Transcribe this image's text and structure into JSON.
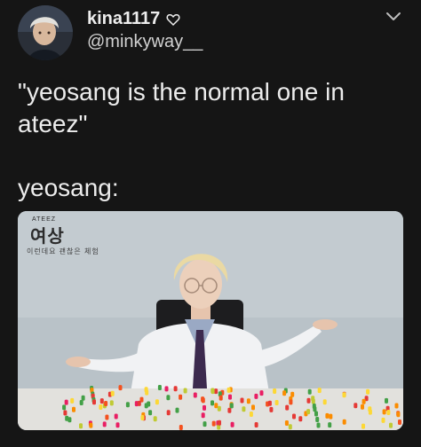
{
  "tweet": {
    "display_name": "kina1117",
    "handle": "@minkyway__",
    "text": "\"yeosang is the normal one in ateez\"\n\nyeosang:"
  },
  "icons": {
    "heart": "heart-outline-icon",
    "chevron": "chevron-down-icon"
  },
  "media": {
    "logo_text": "여상",
    "logo_small": "ATEEZ",
    "caption": "이런데요 괜찮은 체험"
  },
  "colors": {
    "background": "#151515",
    "text": "#ececec",
    "secondary": "#d2d2d2"
  }
}
